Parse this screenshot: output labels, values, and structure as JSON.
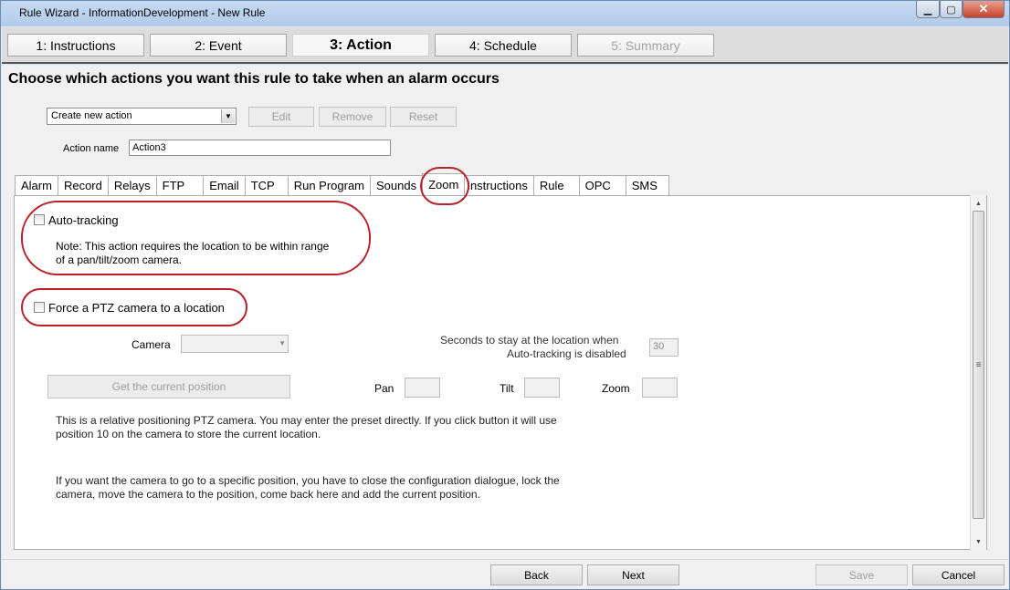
{
  "window": {
    "title": "Rule Wizard - InformationDevelopment - New Rule"
  },
  "steps": [
    {
      "label": "1: Instructions"
    },
    {
      "label": "2: Event"
    },
    {
      "label": "3: Action"
    },
    {
      "label": "4: Schedule"
    },
    {
      "label": "5: Summary"
    }
  ],
  "main": {
    "heading": "Choose which actions you want this rule to take when an alarm occurs",
    "action_select": {
      "value": "Create new action"
    },
    "edit_label": "Edit",
    "remove_label": "Remove",
    "reset_label": "Reset",
    "action_name_label": "Action name",
    "action_name_value": "Action3"
  },
  "subtabs": [
    {
      "label": "Alarm"
    },
    {
      "label": "Record"
    },
    {
      "label": "Relays"
    },
    {
      "label": "FTP"
    },
    {
      "label": "Email"
    },
    {
      "label": "TCP"
    },
    {
      "label": "Run Program"
    },
    {
      "label": "Sounds"
    },
    {
      "label": "Zoom"
    },
    {
      "label": "Instructions"
    },
    {
      "label": "Rule"
    },
    {
      "label": "OPC"
    },
    {
      "label": "SMS"
    }
  ],
  "zoom": {
    "auto_tracking_label": "Auto-tracking",
    "auto_tracking_note_1": "Note: This action requires the location to be within range",
    "auto_tracking_note_2": "of a pan/tilt/zoom camera.",
    "force_ptz_label": "Force a PTZ camera to a location",
    "camera_label": "Camera",
    "camera_value": "",
    "seconds_label_1": "Seconds to stay at the location when",
    "seconds_label_2": "Auto-tracking is disabled",
    "seconds_value": "30",
    "get_position_label": "Get the current position",
    "pan_label": "Pan",
    "tilt_label": "Tilt",
    "zoom_label": "Zoom",
    "para1_line1": "This is a relative positioning PTZ camera.  You may enter the preset directly.  If you click button it will use",
    "para1_line2": "position 10 on the camera to store the current location.",
    "para2_line1": "If you want the camera to go to a specific position, you have to close the configuration dialogue, lock the",
    "para2_line2": "camera, move the camera to the position, come back here and add the current position."
  },
  "footer": {
    "back_label": "Back",
    "next_label": "Next",
    "save_label": "Save",
    "cancel_label": "Cancel"
  },
  "colors": {
    "highlight_oval": "#b8222a",
    "title_bar": "#c5d9f1"
  }
}
